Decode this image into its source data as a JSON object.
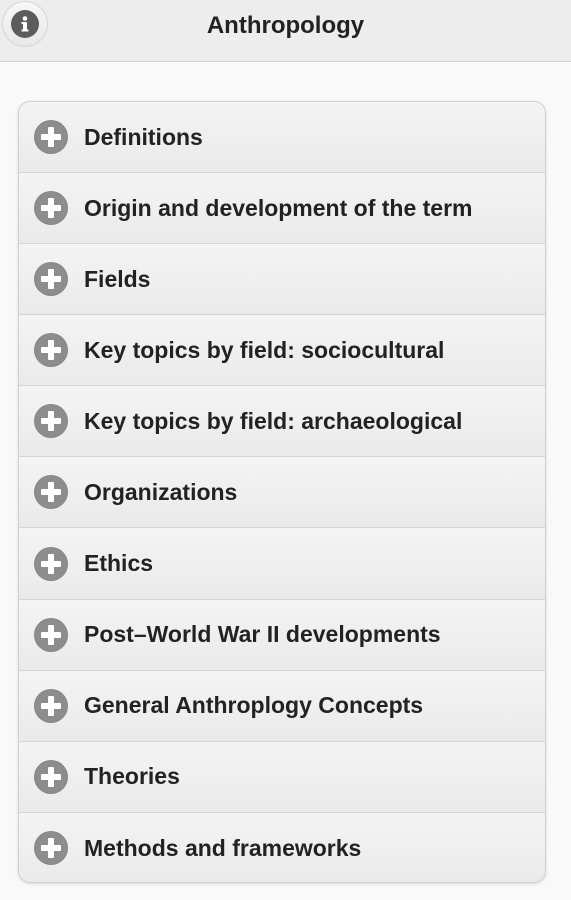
{
  "header": {
    "title": "Anthropology",
    "info_icon": "info-icon"
  },
  "menu": {
    "items": [
      {
        "label": "Definitions"
      },
      {
        "label": "Origin and development of the term"
      },
      {
        "label": "Fields"
      },
      {
        "label": "Key topics by field: sociocultural"
      },
      {
        "label": "Key topics by field: archaeological"
      },
      {
        "label": "Organizations"
      },
      {
        "label": "Ethics"
      },
      {
        "label": "Post–World War II developments"
      },
      {
        "label": "General Anthroplogy Concepts"
      },
      {
        "label": "Theories"
      },
      {
        "label": "Methods and frameworks"
      }
    ],
    "expand_icon": "plus-circle-icon"
  },
  "colors": {
    "header_bg": "#ededed",
    "item_bg": "#f0f0f0",
    "icon_gray": "#8d8d8d",
    "text": "#222222"
  }
}
